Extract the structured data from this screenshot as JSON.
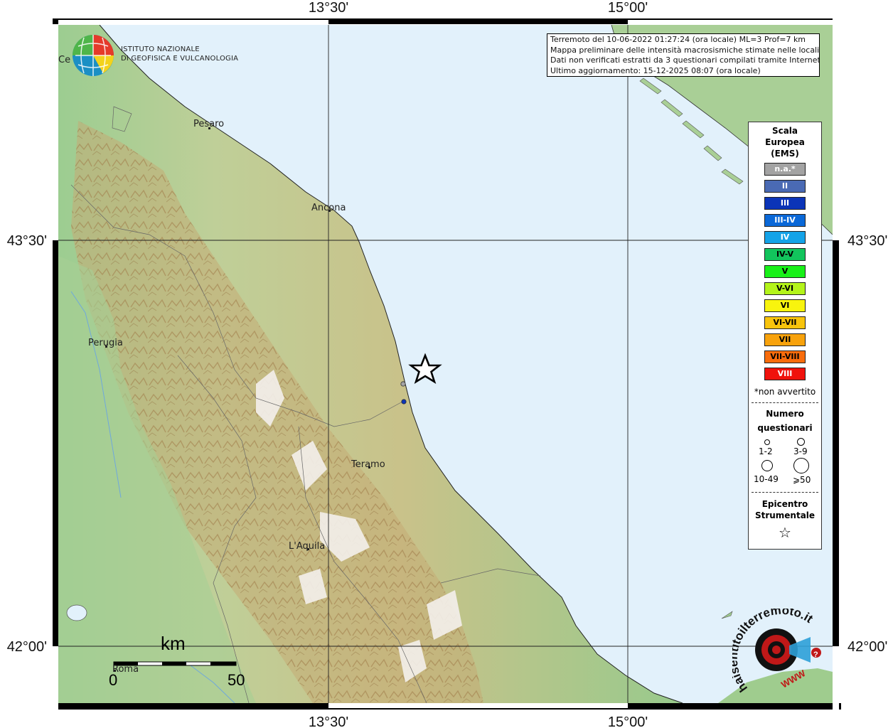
{
  "info": {
    "line1": "Terremoto del 10-06-2022 01:27:24 (ora locale) ML=3 Prof=7 km",
    "line2": "Mappa preliminare delle intensità macrosismiche stimate nelle località",
    "line3": "Dati non verificati estratti da 3 questionari compilati tramite Internet.",
    "line4": "Ultimo aggiornamento: 15-12-2025 08:07 (ora locale)"
  },
  "ticks": {
    "top_left": "13°30'",
    "top_right": "15°00'",
    "bottom_left": "13°30'",
    "bottom_right": "15°00'",
    "left_upper": "43°30'",
    "left_lower": "42°00'",
    "right_upper": "43°30'",
    "right_lower": "42°00'"
  },
  "cities": {
    "pesaro": "Pesaro",
    "ancona": "Ancona",
    "perugia": "Perugia",
    "teramo": "Teramo",
    "laquila": "L'Aquila",
    "roma": "Roma",
    "cesena_fragment": "Ce"
  },
  "ingv": {
    "line1": "ISTITUTO NAZIONALE",
    "line2": "DI GEOFISICA E VULCANOLOGIA"
  },
  "scalebar": {
    "unit": "km",
    "min": "0",
    "max": "50"
  },
  "legend": {
    "title1": "Scala",
    "title2": "Europea",
    "title3": "(EMS)",
    "items": [
      {
        "label": "n.a.*",
        "color": "#a3a3a3",
        "text": "#ffffff"
      },
      {
        "label": "II",
        "color": "#4a6ab4",
        "text": "#ffffff"
      },
      {
        "label": "III",
        "color": "#0b34b8",
        "text": "#ffffff"
      },
      {
        "label": "III-IV",
        "color": "#0a68d8",
        "text": "#ffffff"
      },
      {
        "label": "IV",
        "color": "#14a3e8",
        "text": "#ffffff"
      },
      {
        "label": "IV-V",
        "color": "#12c45c",
        "text": "#000000"
      },
      {
        "label": "V",
        "color": "#18f018",
        "text": "#000000"
      },
      {
        "label": "V-VI",
        "color": "#b4f41a",
        "text": "#000000"
      },
      {
        "label": "VI",
        "color": "#f8f40e",
        "text": "#000000"
      },
      {
        "label": "VI-VII",
        "color": "#f8c40c",
        "text": "#000000"
      },
      {
        "label": "VII",
        "color": "#f8a20c",
        "text": "#000000"
      },
      {
        "label": "VII-VIII",
        "color": "#f86c0c",
        "text": "#000000"
      },
      {
        "label": "VIII",
        "color": "#f0120c",
        "text": "#ffffff"
      }
    ],
    "note": "*non avvertito",
    "count_title1": "Numero",
    "count_title2": "questionari",
    "counts": [
      "1-2",
      "3-9",
      "10-49",
      "⩾50"
    ],
    "epi_title1": "Epicentro",
    "epi_title2": "Strumentale",
    "epi_symbol": "☆"
  },
  "observations": [
    {
      "intensity": "n.a.*",
      "color": "#a3a3a3"
    },
    {
      "intensity": "III",
      "color": "#0b34b8"
    }
  ],
  "hst_logo": {
    "text": "haisentitoilterremoto.it",
    "www": "WWW",
    "q": "?"
  },
  "colors": {
    "sea": "#e2f1fb",
    "land_low": "#9fc98f",
    "land_mid": "#bccd96",
    "mountain": "#b99a63",
    "peak": "#f3efea"
  }
}
